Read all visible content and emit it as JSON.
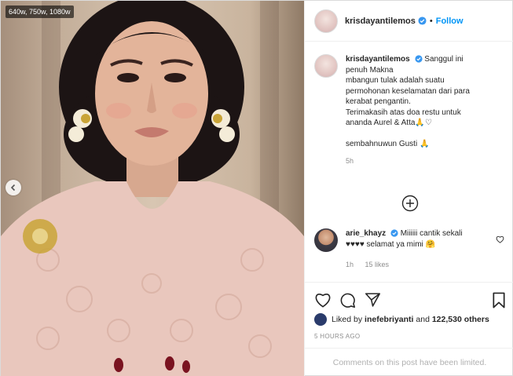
{
  "media": {
    "size_badge": "640w, 750w, 1080w"
  },
  "header": {
    "username": "krisdayantilemos",
    "separator": "•",
    "follow_label": "Follow"
  },
  "caption": {
    "username": "krisdayantilemos",
    "lines": [
      "Sanggul ini",
      "penuh Makna",
      "mbangun tulak adalah suatu",
      "permohonan keselamatan dari para",
      "kerabat pengantin.",
      "Terimakasih atas doa restu untuk",
      "ananda Aurel & Atta🙏♡",
      "sembahnuwun Gusti 🙏"
    ],
    "time": "5h"
  },
  "comment": {
    "username": "arie_khayz",
    "text_line1": "Miiiiii cantik sekali",
    "text_line2": "♥♥♥♥ selamat ya mimi 🤗",
    "time": "1h",
    "likes": "15 likes"
  },
  "likes": {
    "prefix": "Liked by",
    "user": "inefebriyanti",
    "middle": "and",
    "count": "122,530 others"
  },
  "posted_ago": "5 HOURS AGO",
  "comments_limited": "Comments on this post have been limited.",
  "colors": {
    "accent": "#0095f6",
    "verified": "#3897f0",
    "secondary_text": "#8e8e8e",
    "heart_red": "#ed4956"
  }
}
